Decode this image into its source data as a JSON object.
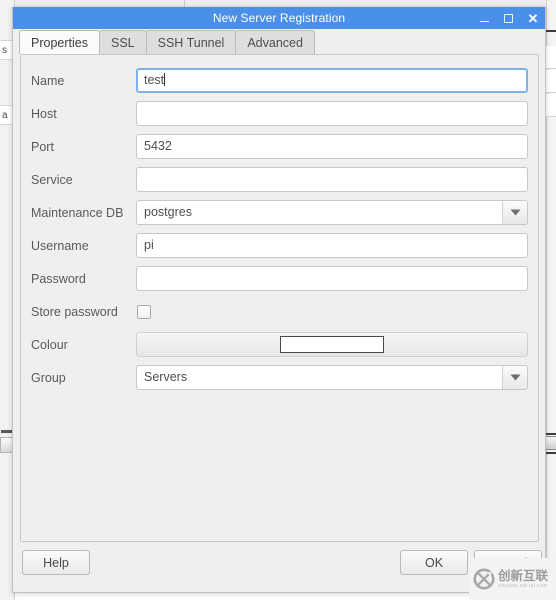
{
  "window": {
    "title": "New Server Registration",
    "controls": {
      "minimize": "minimize-icon",
      "maximize": "maximize-icon",
      "close": "✕"
    }
  },
  "tabs": [
    {
      "label": "Properties",
      "active": true
    },
    {
      "label": "SSL",
      "active": false
    },
    {
      "label": "SSH Tunnel",
      "active": false
    },
    {
      "label": "Advanced",
      "active": false
    }
  ],
  "form": {
    "fields": [
      {
        "label": "Name",
        "type": "text",
        "value": "test",
        "placeholder": "",
        "focused": true
      },
      {
        "label": "Host",
        "type": "text",
        "value": "",
        "placeholder": "",
        "focused": false
      },
      {
        "label": "Port",
        "type": "text",
        "value": "5432",
        "placeholder": "",
        "focused": false
      },
      {
        "label": "Service",
        "type": "text",
        "value": "",
        "placeholder": "",
        "focused": false
      },
      {
        "label": "Maintenance DB",
        "type": "combo",
        "value": "postgres",
        "placeholder": "",
        "focused": false
      },
      {
        "label": "Username",
        "type": "text",
        "value": "pi",
        "placeholder": "",
        "focused": false
      },
      {
        "label": "Password",
        "type": "password",
        "value": "",
        "placeholder": "",
        "focused": false
      },
      {
        "label": "Store password",
        "type": "checkbox",
        "checked": false
      },
      {
        "label": "Colour",
        "type": "colour",
        "value": "#ffffff"
      },
      {
        "label": "Group",
        "type": "combo",
        "value": "Servers",
        "placeholder": "",
        "focused": false
      }
    ]
  },
  "footer": {
    "help_label": "Help",
    "ok_label": "OK",
    "cancel_label": "Cancel"
  },
  "watermark": {
    "text_cn": "创新互联",
    "text_pinyin": "CHUANG XIN HU LIAN"
  },
  "background": {
    "left_fragments": [
      "s",
      "a"
    ]
  },
  "colors": {
    "titlebar": "#4a90e8",
    "dialog_bg": "#efefef",
    "focus_border": "#7fb3e8",
    "label_text": "#5a5a5a"
  }
}
